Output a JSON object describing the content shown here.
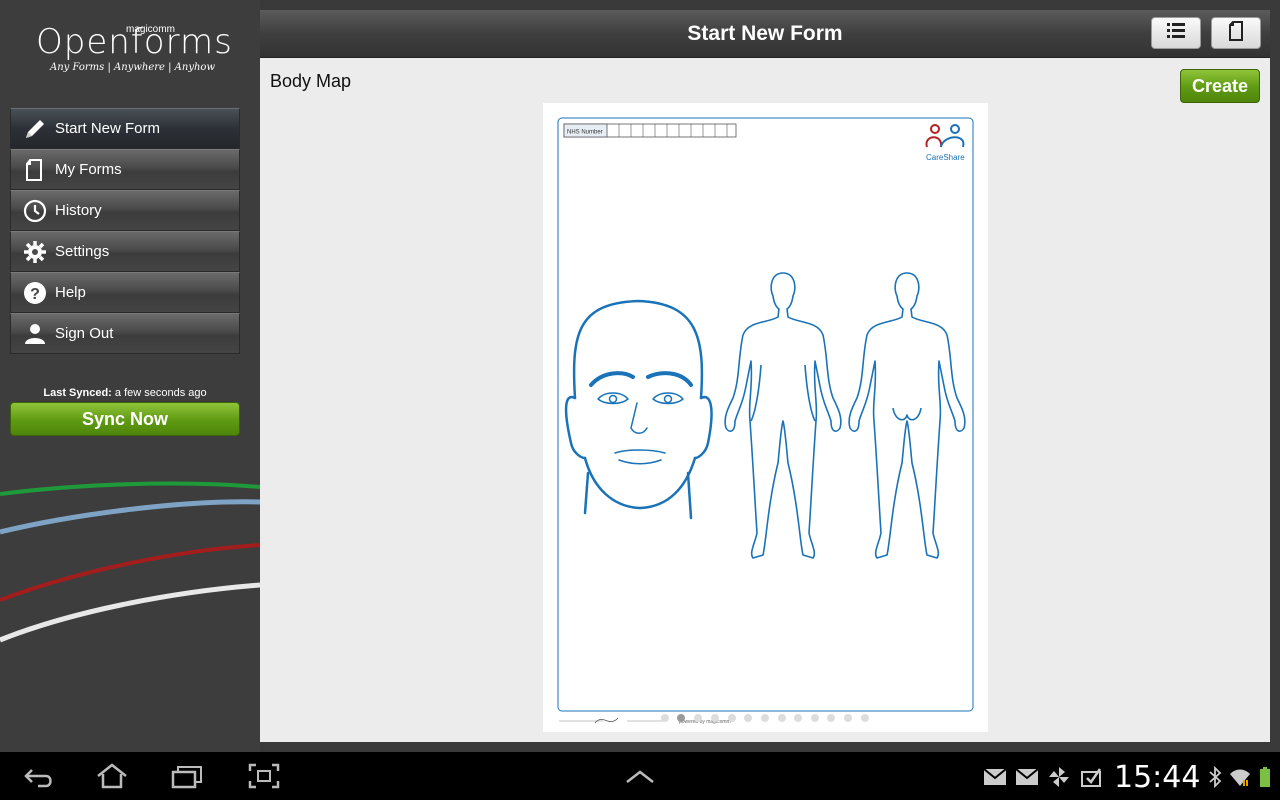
{
  "app": {
    "logo_brand": "magicomm",
    "logo_name": "Openforms",
    "logo_tagline": "Any Forms | Anywhere | Anyhow"
  },
  "sidebar": {
    "items": [
      {
        "label": "Start New Form",
        "icon": "pencil-icon",
        "active": true
      },
      {
        "label": "My Forms",
        "icon": "document-icon",
        "active": false
      },
      {
        "label": "History",
        "icon": "clock-icon",
        "active": false
      },
      {
        "label": "Settings",
        "icon": "gear-icon",
        "active": false
      },
      {
        "label": "Help",
        "icon": "question-icon",
        "active": false
      },
      {
        "label": "Sign Out",
        "icon": "user-icon",
        "active": false
      }
    ],
    "last_synced_label": "Last Synced:",
    "last_synced_value": "a few seconds ago",
    "sync_button": "Sync Now"
  },
  "header": {
    "title": "Start New Form",
    "list_view_icon": "list-icon",
    "page_view_icon": "page-icon"
  },
  "form": {
    "title": "Body Map",
    "create_button": "Create",
    "preview": {
      "nhs_label": "NHS Number",
      "brand": "CareShare",
      "footer_text": "powered by magicomm",
      "page_count": 13,
      "current_page": 2
    }
  },
  "status_bar": {
    "time": "15:44"
  },
  "colors": {
    "accent_green": "#5e9a12",
    "diagram_blue": "#1a73b8",
    "careshare_red": "#b22222"
  }
}
